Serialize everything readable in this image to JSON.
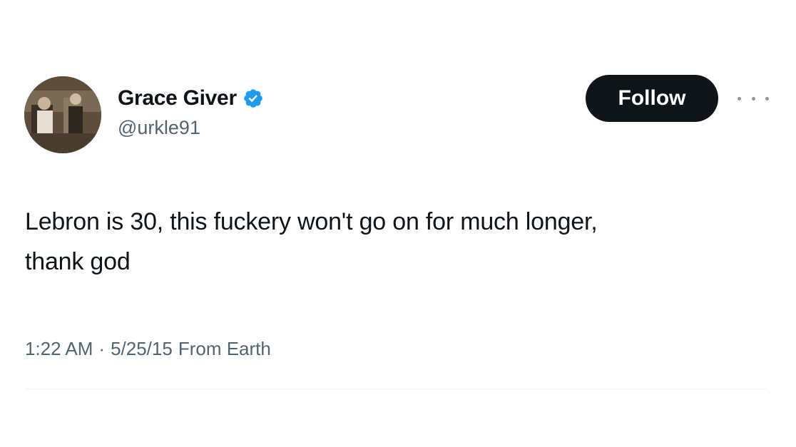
{
  "author": {
    "display_name": "Grace Giver",
    "handle": "@urkle91",
    "verified": true,
    "verified_color": "#1d9bf0"
  },
  "actions": {
    "follow_label": "Follow",
    "more_icon": "more-horizontal-icon"
  },
  "tweet": {
    "text_line1": "Lebron is 30, this fuckery won't go on for much longer,",
    "text_line2": "thank god"
  },
  "meta": {
    "time": "1:22 AM",
    "separator": "·",
    "date": "5/25/15",
    "source": "From Earth"
  },
  "colors": {
    "text_primary": "#0f1419",
    "text_secondary": "#536471",
    "button_bg": "#0f1419"
  }
}
